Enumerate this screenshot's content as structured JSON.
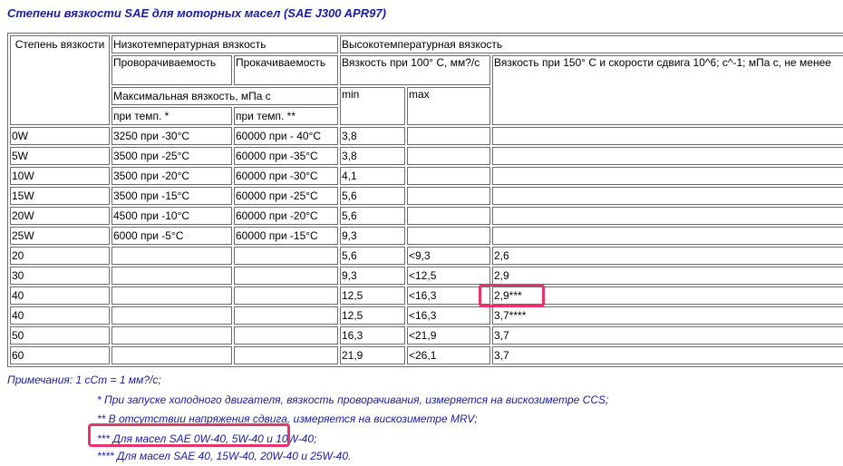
{
  "title": "Степени вязкости SAE для моторных масел (SAE J300 APR97)",
  "header": {
    "grade": "Степень вязкости",
    "low_temp": "Низкотемпературная вязкость",
    "high_temp": "Высокотемпературная вязкость",
    "cranking": "Проворачиваемость",
    "pumping": "Прокачиваемость",
    "visc100": "Вязкость при 100° С, мм?/с",
    "visc150": "Вязкость при 150° С и скорости сдвига 10^6; с^-1; мПа с, не менее",
    "max_visc": "Максимальная вязкость, мПа с",
    "temp1": "при темп. *",
    "temp2": "при темп. **",
    "min": "min",
    "max": "max"
  },
  "rows": [
    {
      "grade": "0W",
      "crank": "3250 при -30°С",
      "pump": "60000 при - 40°С",
      "min": "3,8",
      "max": "",
      "hths": ""
    },
    {
      "grade": "5W",
      "crank": "3500 при -25°С",
      "pump": "60000 при -35°С",
      "min": "3,8",
      "max": "",
      "hths": ""
    },
    {
      "grade": "10W",
      "crank": "3500 при -20°С",
      "pump": "60000 при -30°С",
      "min": "4,1",
      "max": "",
      "hths": ""
    },
    {
      "grade": "15W",
      "crank": "3500 при -15°С",
      "pump": "60000 при -25°С",
      "min": "5,6",
      "max": "",
      "hths": ""
    },
    {
      "grade": "20W",
      "crank": "4500 при -10°С",
      "pump": "60000 при -20°С",
      "min": "5,6",
      "max": "",
      "hths": ""
    },
    {
      "grade": "25W",
      "crank": "6000 при -5°С",
      "pump": "60000 при -15°С",
      "min": "9,3",
      "max": "",
      "hths": ""
    },
    {
      "grade": "20",
      "crank": "",
      "pump": "",
      "min": "5,6",
      "max": "<9,3",
      "hths": "2,6"
    },
    {
      "grade": "30",
      "crank": "",
      "pump": "",
      "min": "9,3",
      "max": "<12,5",
      "hths": "2,9"
    },
    {
      "grade": "40",
      "crank": "",
      "pump": "",
      "min": "12,5",
      "max": "<16,3",
      "hths": "2,9***"
    },
    {
      "grade": "40",
      "crank": "",
      "pump": "",
      "min": "12,5",
      "max": "<16,3",
      "hths": "3,7****"
    },
    {
      "grade": "50",
      "crank": "",
      "pump": "",
      "min": "16,3",
      "max": "<21,9",
      "hths": "3,7"
    },
    {
      "grade": "60",
      "crank": "",
      "pump": "",
      "min": "21,9",
      "max": "<26,1",
      "hths": "3,7"
    }
  ],
  "notes": {
    "n0": "Примечания: 1 сСт = 1 мм?/с;",
    "n1": "* При запуске холодного двигателя, вязкость проворачивания, измеряется на вискозиметре CCS;",
    "n2": "** В отсутствии напряжения сдвига, измеряется на вискозиметре MRV;",
    "n3": "*** Для масел SAE 0W-40, 5W-40 и 10W-40;",
    "n4": "**** Для масел SAE 40, 15W-40, 20W-40 и 25W-40."
  },
  "colors": {
    "title": "#1a1aa6",
    "highlight": "#e8336b",
    "border": "#6b6b6b"
  }
}
